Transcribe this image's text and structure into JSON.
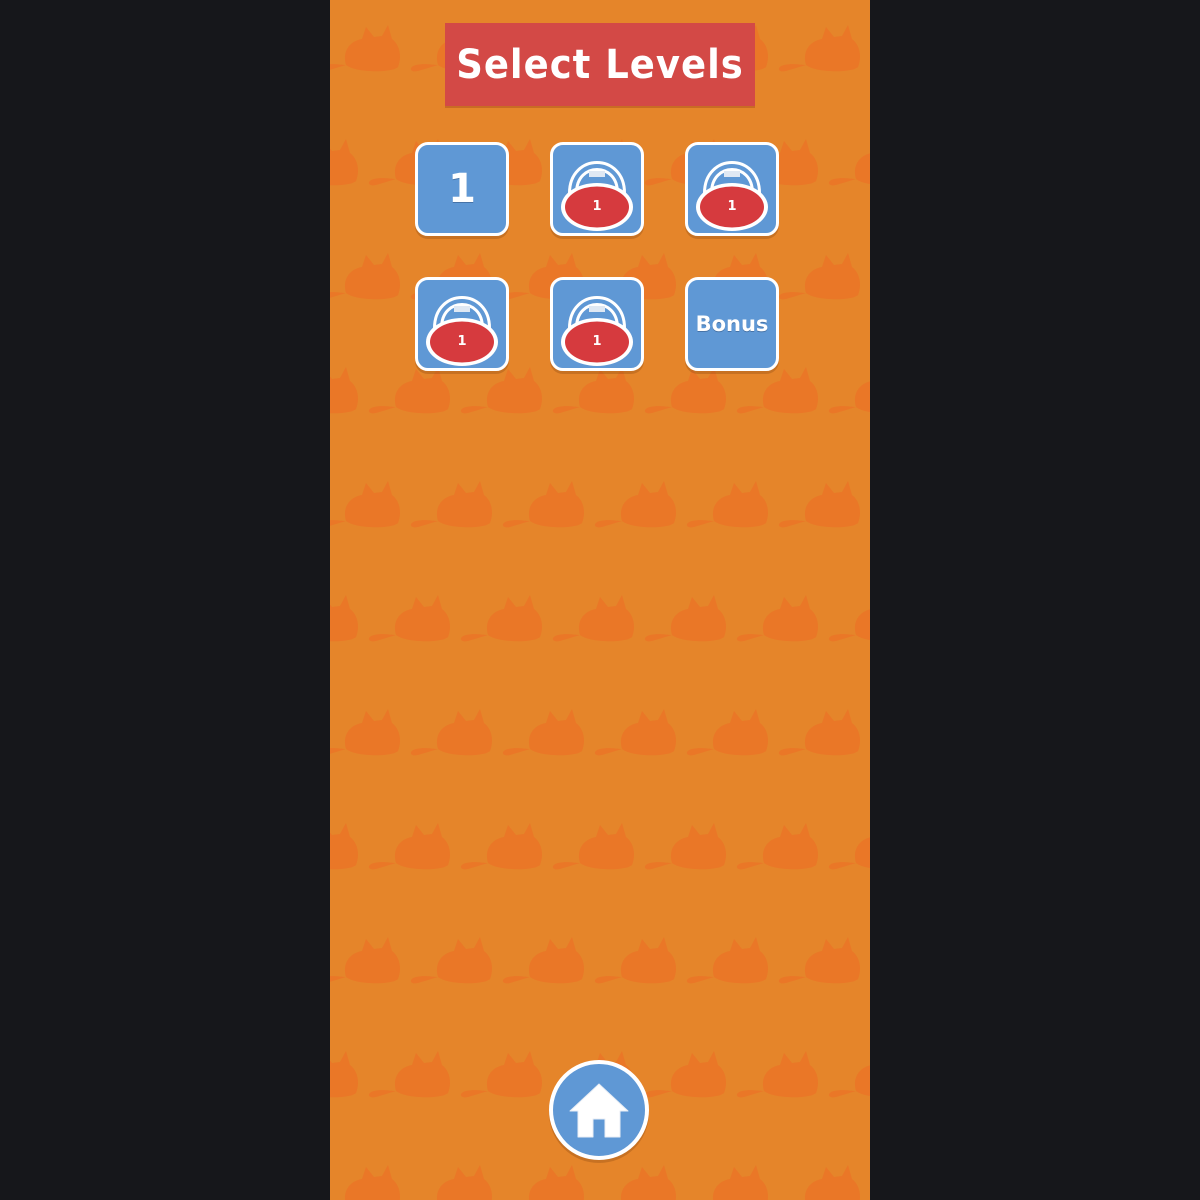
{
  "title": "Select Levels",
  "levels": [
    {
      "label": "1",
      "locked": false
    },
    {
      "label": "1",
      "locked": true
    },
    {
      "label": "1",
      "locked": true
    },
    {
      "label": "1",
      "locked": true
    },
    {
      "label": "1",
      "locked": true
    },
    {
      "label": "Bonus",
      "locked": false
    }
  ],
  "home_button": {
    "icon": "home-icon"
  },
  "colors": {
    "background": "#e5852a",
    "pattern": "#ea7727",
    "banner": "#d34946",
    "tile": "#5f98d5",
    "lock": "#d63a3e",
    "outer": "#16171b"
  }
}
